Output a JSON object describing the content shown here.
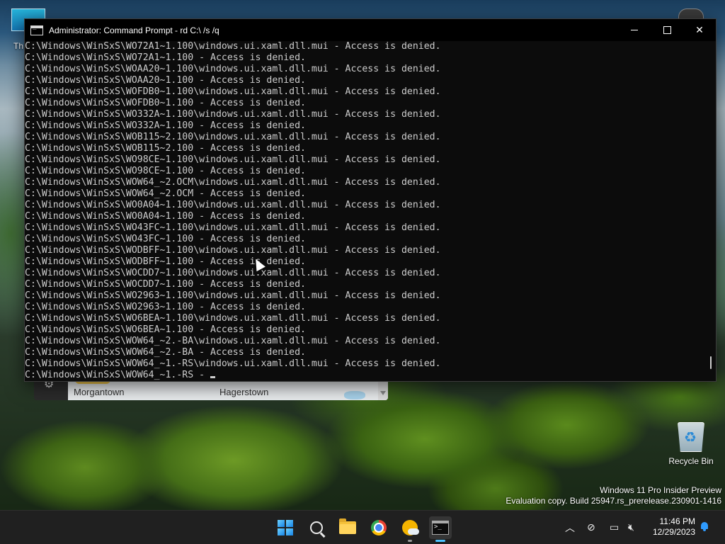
{
  "window": {
    "title": "Administrator: Command Prompt - rd  C:\\ /s /q",
    "minimize_label": "minimize",
    "maximize_label": "maximize",
    "close_label": "✕"
  },
  "console_lines": [
    "C:\\Windows\\WinSxS\\WO72A1~1.100\\windows.ui.xaml.dll.mui - Access is denied.",
    "C:\\Windows\\WinSxS\\WO72A1~1.100 - Access is denied.",
    "C:\\Windows\\WinSxS\\WOAA20~1.100\\windows.ui.xaml.dll.mui - Access is denied.",
    "C:\\Windows\\WinSxS\\WOAA20~1.100 - Access is denied.",
    "C:\\Windows\\WinSxS\\WOFDB0~1.100\\windows.ui.xaml.dll.mui - Access is denied.",
    "C:\\Windows\\WinSxS\\WOFDB0~1.100 - Access is denied.",
    "C:\\Windows\\WinSxS\\WO332A~1.100\\windows.ui.xaml.dll.mui - Access is denied.",
    "C:\\Windows\\WinSxS\\WO332A~1.100 - Access is denied.",
    "C:\\Windows\\WinSxS\\WOB115~2.100\\windows.ui.xaml.dll.mui - Access is denied.",
    "C:\\Windows\\WinSxS\\WOB115~2.100 - Access is denied.",
    "C:\\Windows\\WinSxS\\WO98CE~1.100\\windows.ui.xaml.dll.mui - Access is denied.",
    "C:\\Windows\\WinSxS\\WO98CE~1.100 - Access is denied.",
    "C:\\Windows\\WinSxS\\WOW64_~2.OCM\\windows.ui.xaml.dll.mui - Access is denied.",
    "C:\\Windows\\WinSxS\\WOW64_~2.OCM - Access is denied.",
    "C:\\Windows\\WinSxS\\WO0A04~1.100\\windows.ui.xaml.dll.mui - Access is denied.",
    "C:\\Windows\\WinSxS\\WO0A04~1.100 - Access is denied.",
    "C:\\Windows\\WinSxS\\WO43FC~1.100\\windows.ui.xaml.dll.mui - Access is denied.",
    "C:\\Windows\\WinSxS\\WO43FC~1.100 - Access is denied.",
    "C:\\Windows\\WinSxS\\WODBFF~1.100\\windows.ui.xaml.dll.mui - Access is denied.",
    "C:\\Windows\\WinSxS\\WODBFF~1.100 - Access is denied.",
    "C:\\Windows\\WinSxS\\WOCDD7~1.100\\windows.ui.xaml.dll.mui - Access is denied.",
    "C:\\Windows\\WinSxS\\WOCDD7~1.100 - Access is denied.",
    "C:\\Windows\\WinSxS\\WO2963~1.100\\windows.ui.xaml.dll.mui - Access is denied.",
    "C:\\Windows\\WinSxS\\WO2963~1.100 - Access is denied.",
    "C:\\Windows\\WinSxS\\WO6BEA~1.100\\windows.ui.xaml.dll.mui - Access is denied.",
    "C:\\Windows\\WinSxS\\WO6BEA~1.100 - Access is denied.",
    "C:\\Windows\\WinSxS\\WOW64_~2.-BA\\windows.ui.xaml.dll.mui - Access is denied.",
    "C:\\Windows\\WinSxS\\WOW64_~2.-BA - Access is denied.",
    "C:\\Windows\\WinSxS\\WOW64_~1.-RS\\windows.ui.xaml.dll.mui - Access is denied.",
    "C:\\Windows\\WinSxS\\WOW64_~1.-RS - "
  ],
  "desktop": {
    "this_pc_label": "Th",
    "recycle_bin_label": "Recycle Bin"
  },
  "map_widget": {
    "town_1": "Morgantown",
    "town_2": "Hagerstown"
  },
  "watermark": {
    "line1": "Windows 11 Pro Insider Preview",
    "line2": "Evaluation copy. Build 25947.rs_prerelease.230901-1416"
  },
  "taskbar": {
    "icons": [
      "start-icon",
      "search-icon",
      "file-explorer-icon",
      "chrome-icon",
      "weather-icon",
      "command-prompt-icon"
    ],
    "clock_time": "11:46 PM",
    "clock_date": "12/29/2023",
    "tray_chevron": "^"
  },
  "colors": {
    "console_bg": "#0c0c0c",
    "console_fg": "#cccccc",
    "taskbar_bg": "#202020",
    "accent": "#4cc2ff"
  }
}
